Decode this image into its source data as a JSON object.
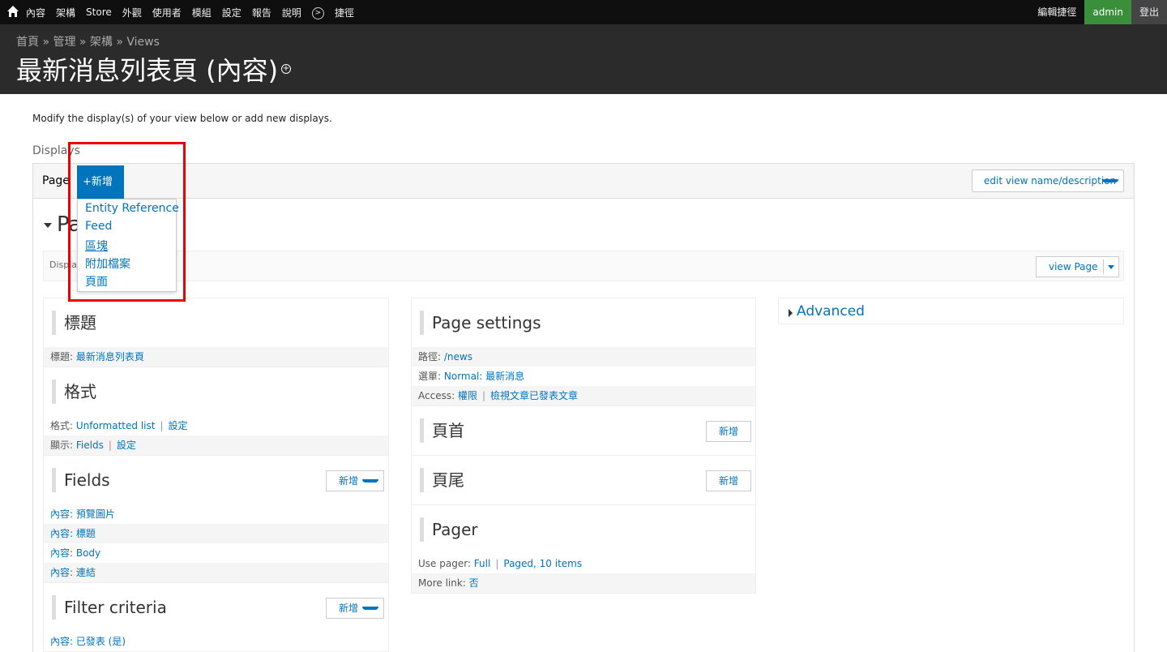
{
  "toolbar": {
    "menu": [
      "內容",
      "架構",
      "Store",
      "外觀",
      "使用者",
      "模組",
      "設定",
      "報告",
      "說明"
    ],
    "shortcuts": "捷徑",
    "edit_shortcuts": "編輯捷徑",
    "user": "admin",
    "logout": "登出"
  },
  "header": {
    "breadcrumb": "首頁 » 管理 » 架構 » Views",
    "title": "最新消息列表頁 (內容)"
  },
  "intro": "Modify the display(s) of your view below or add new displays.",
  "displays_label": "Displays",
  "tabs": {
    "page_tab": "Page",
    "add_label": "新增",
    "edit_desc": "edit view name/description"
  },
  "dropdown": {
    "options": [
      "Entity Reference",
      "Feed",
      "區塊",
      "附加檔案",
      "頁面"
    ]
  },
  "display": {
    "heading": "Pa",
    "bar_label": "Displa",
    "view_page": "view Page"
  },
  "col1": {
    "title_section": "標題",
    "title_row_label": "標題:",
    "title_row_value": "最新消息列表頁",
    "format_section": "格式",
    "format_row_label": "格式:",
    "format_row_value": "Unformatted list",
    "format_row_settings": "設定",
    "show_row_label": "顯示:",
    "show_row_value": "Fields",
    "show_row_settings": "設定",
    "fields_section": "Fields",
    "fields_add": "新增",
    "fields": [
      "內容: 預覽圖片",
      "內容: 標題",
      "內容: Body",
      "內容: 連結"
    ],
    "filter_section": "Filter criteria",
    "filter_add": "新增",
    "filters": [
      "內容: 已發表 (是)"
    ]
  },
  "col2": {
    "page_settings": "Page settings",
    "path_label": "路徑:",
    "path_value": "/news",
    "menu_label": "選單:",
    "menu_value": "Normal: 最新消息",
    "access_label": "Access:",
    "access_value1": "權限",
    "access_value2": "檢視文章已發表文章",
    "header_section": "頁首",
    "header_add": "新增",
    "footer_section": "頁尾",
    "footer_add": "新增",
    "pager_section": "Pager",
    "use_pager_label": "Use pager:",
    "use_pager_value1": "Full",
    "use_pager_value2": "Paged, 10 items",
    "more_link_label": "More link:",
    "more_link_value": "否"
  },
  "col3": {
    "advanced": "Advanced"
  }
}
